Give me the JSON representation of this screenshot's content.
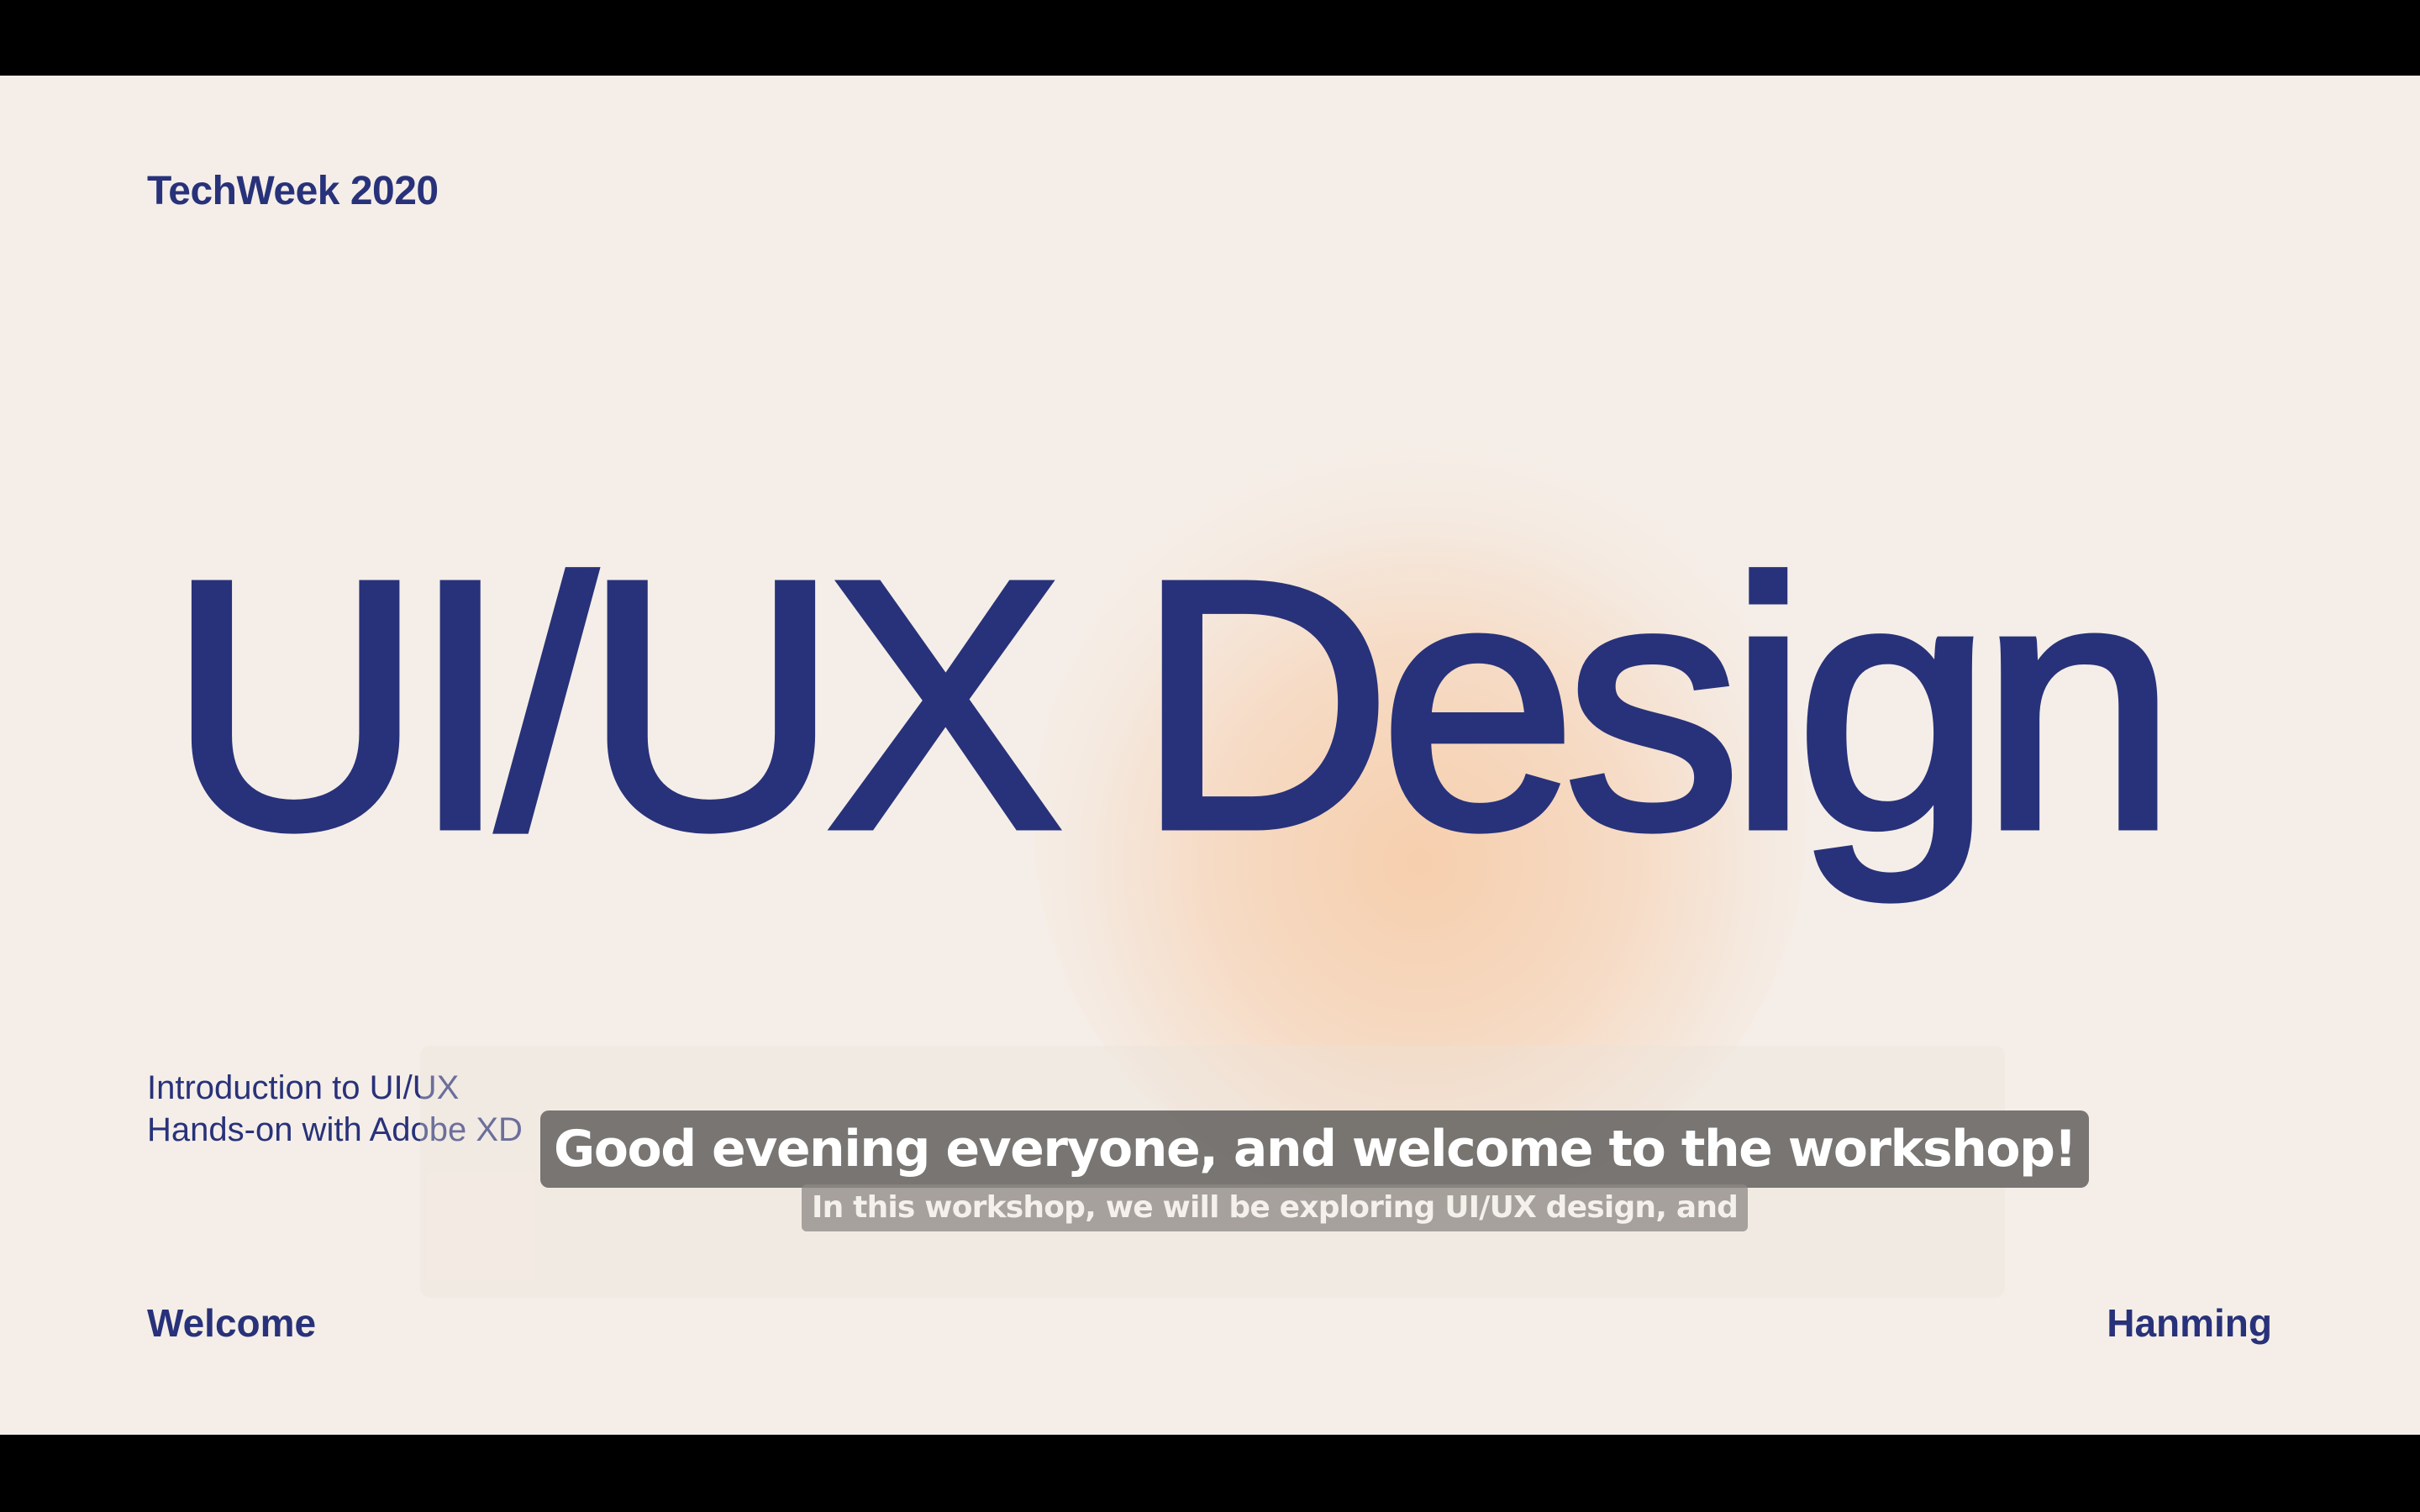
{
  "slide": {
    "brand": "TechWeek 2020",
    "title": "UI/UX Design",
    "topics": [
      "Introduction to UI/UX",
      "Hands-on with Adobe XD"
    ],
    "footer_left": "Welcome",
    "footer_right": "Hanming"
  },
  "captions": {
    "line1": "Good evening everyone, and welcome to the workshop!",
    "line2": "In this workshop, we will be exploring UI/UX design, and"
  },
  "colors": {
    "accent": "#28327a",
    "background": "#f5eee8",
    "glow": "#f6cdaa"
  }
}
